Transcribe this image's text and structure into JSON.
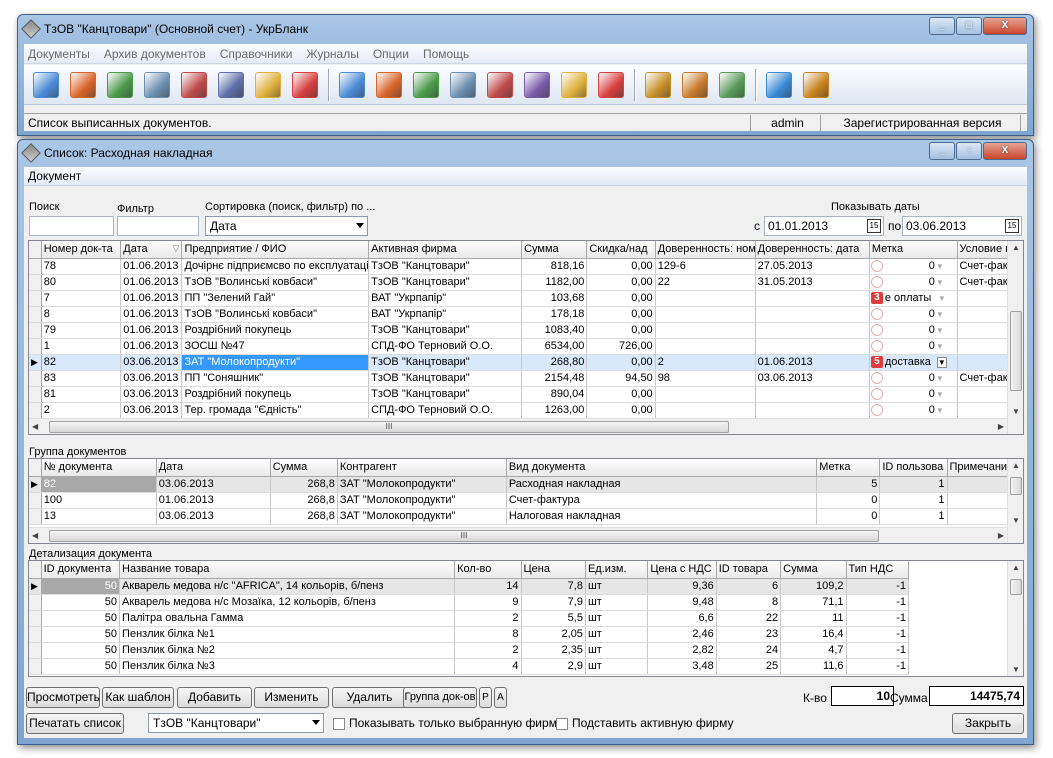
{
  "main_window": {
    "title": "ТзОВ \"Канцтовари\" (Основной счет) - УкрБланк",
    "controls": [
      "_",
      "□",
      "X"
    ],
    "menu": [
      "Документы",
      "Архив документов",
      "Справочники",
      "Журналы",
      "Опции",
      "Помощь"
    ],
    "toolbar_icons": [
      "new-document-icon",
      "delete-document-icon",
      "calculator-icon",
      "truck-icon",
      "truck-delete-icon",
      "building-icon",
      "user-document-icon",
      "checkmark-document-icon",
      "new-document-2-icon",
      "delete-document-2-icon",
      "calculator-2-icon",
      "truck-2-icon",
      "truck-delete-2-icon",
      "sign-icon",
      "user-document-2-icon",
      "checkmark-document-2-icon",
      "users-icon",
      "package-icon",
      "user-swap-icon",
      "settings-icon",
      "exit-door-icon"
    ],
    "status": {
      "text": "Список выписанных документов.",
      "user": "admin",
      "license": "Зарегистрированная версия"
    }
  },
  "list_window": {
    "title": "Список: Расходная накладная",
    "menu": [
      "Документ"
    ],
    "filters": {
      "search_label": "Поиск",
      "filter_label": "Фильтр",
      "sort_label": "Сортировка (поиск, фильтр) по ...",
      "sort_value": "Дата",
      "show_dates_label": "Показывать даты",
      "from_label": "с",
      "from_value": "01.01.2013",
      "to_label": "по",
      "to_value": "03.06.2013"
    },
    "docs_grid": {
      "columns": [
        "Номер док-та",
        "Дата",
        "Предприятие / ФИО",
        "Активная фирма",
        "Сумма",
        "Скидка/над",
        "Доверенность: ном",
        "Доверенность: дата",
        "Метка",
        "Условие пр"
      ],
      "rows": [
        [
          "78",
          "01.06.2013",
          "Дочірнє підприємсво по експлуатаці",
          "ТзОВ \"Канцтовари\"",
          "818,16",
          "0,00",
          "129-6",
          "27.05.2013",
          "",
          "0",
          "Счет-фактур"
        ],
        [
          "80",
          "01.06.2013",
          "ТзОВ \"Волинські ковбаси\"",
          "ТзОВ \"Канцтовари\"",
          "1182,00",
          "0,00",
          "22",
          "31.05.2013",
          "",
          "0",
          "Счет-фактур"
        ],
        [
          "7",
          "01.06.2013",
          "ПП \"Зелений Гай\"",
          "ВАТ \"Укрпапір\"",
          "103,68",
          "0,00",
          "",
          "",
          "3",
          "е оплаты",
          ""
        ],
        [
          "8",
          "01.06.2013",
          "ТзОВ \"Волинські ковбаси\"",
          "ВАТ \"Укрпапір\"",
          "178,18",
          "0,00",
          "",
          "",
          "",
          "0",
          ""
        ],
        [
          "79",
          "01.06.2013",
          "Роздрібний покупець",
          "ТзОВ \"Канцтовари\"",
          "1083,40",
          "0,00",
          "",
          "",
          "",
          "0",
          ""
        ],
        [
          "1",
          "01.06.2013",
          "ЗОСШ №47",
          "СПД-ФО Терновий О.О.",
          "6534,00",
          "726,00",
          "",
          "",
          "",
          "0",
          ""
        ],
        [
          "82",
          "03.06.2013",
          "ЗАТ \"Молокопродукти\"",
          "ТзОВ \"Канцтовари\"",
          "268,80",
          "0,00",
          "2",
          "01.06.2013",
          "5",
          "доставка",
          ""
        ],
        [
          "83",
          "03.06.2013",
          "ПП \"Соняшник\"",
          "ТзОВ \"Канцтовари\"",
          "2154,48",
          "94,50",
          "98",
          "03.06.2013",
          "",
          "0",
          "Счет-фактур"
        ],
        [
          "81",
          "03.06.2013",
          "Роздрібний покупець",
          "ТзОВ \"Канцтовари\"",
          "890,04",
          "0,00",
          "",
          "",
          "",
          "0",
          ""
        ],
        [
          "2",
          "03.06.2013",
          "Тер. громада \"Єдність\"",
          "СПД-ФО Терновий О.О.",
          "1263,00",
          "0,00",
          "",
          "",
          "",
          "0",
          ""
        ]
      ]
    },
    "group": {
      "label": "Группа документов",
      "columns": [
        "№ документа",
        "Дата",
        "Сумма",
        "Контрагент",
        "Вид документа",
        "Метка",
        "ID пользова",
        "Примечание"
      ],
      "rows": [
        [
          "82",
          "03.06.2013",
          "268,8",
          "ЗАТ \"Молокопродукти\"",
          "Расходная накладная",
          "5",
          "1",
          ""
        ],
        [
          "100",
          "01.06.2013",
          "268,8",
          "ЗАТ \"Молокопродукти\"",
          "Счет-фактура",
          "0",
          "1",
          ""
        ],
        [
          "13",
          "03.06.2013",
          "268,8",
          "ЗАТ \"Молокопродукти\"",
          "Налоговая накладная",
          "0",
          "1",
          ""
        ]
      ]
    },
    "detail": {
      "label": "Детализация документа",
      "columns": [
        "ID документа",
        "Название товара",
        "Кол-во",
        "Цена",
        "Ед.изм.",
        "Цена с НДС",
        "ID товара",
        "Сумма",
        "Тип НДС"
      ],
      "rows": [
        [
          "50",
          "Акварель медова н/с  \"AFRICA\", 14 кольорів, б/пенз",
          "14",
          "7,8",
          "шт",
          "9,36",
          "6",
          "109,2",
          "-1"
        ],
        [
          "50",
          "Акварель медова н/с  Мозаїка, 12 кольорів, б/пенз",
          "9",
          "7,9",
          "шт",
          "9,48",
          "8",
          "71,1",
          "-1"
        ],
        [
          "50",
          "Палітра овальна Гамма",
          "2",
          "5,5",
          "шт",
          "6,6",
          "22",
          "11",
          "-1"
        ],
        [
          "50",
          "Пензлик білка №1",
          "8",
          "2,05",
          "шт",
          "2,46",
          "23",
          "16,4",
          "-1"
        ],
        [
          "50",
          "Пензлик білка №2",
          "2",
          "2,35",
          "шт",
          "2,82",
          "24",
          "4,7",
          "-1"
        ],
        [
          "50",
          "Пензлик білка №3",
          "4",
          "2,9",
          "шт",
          "3,48",
          "25",
          "11,6",
          "-1"
        ]
      ]
    },
    "buttons": {
      "view": "Просмотреть",
      "as_template": "Как шаблон",
      "add": "Добавить",
      "edit": "Изменить",
      "delete": "Удалить",
      "group": "Группа док-ов",
      "r": "Р",
      "a": "А",
      "print": "Печатать список",
      "close": "Закрыть"
    },
    "totals": {
      "count_label": "К-во",
      "count_value": "10",
      "sum_label": "Сумма",
      "sum_value": "14475,74"
    },
    "firm_combo": "ТзОВ \"Канцтовари\"",
    "checkbox1": "Показывать только выбранную фирму",
    "checkbox2": "Подставить активную фирму"
  },
  "colors": {
    "selection": "#3399ff",
    "badge": "#e23a3a",
    "title_gradient": "#a9c6e6"
  }
}
